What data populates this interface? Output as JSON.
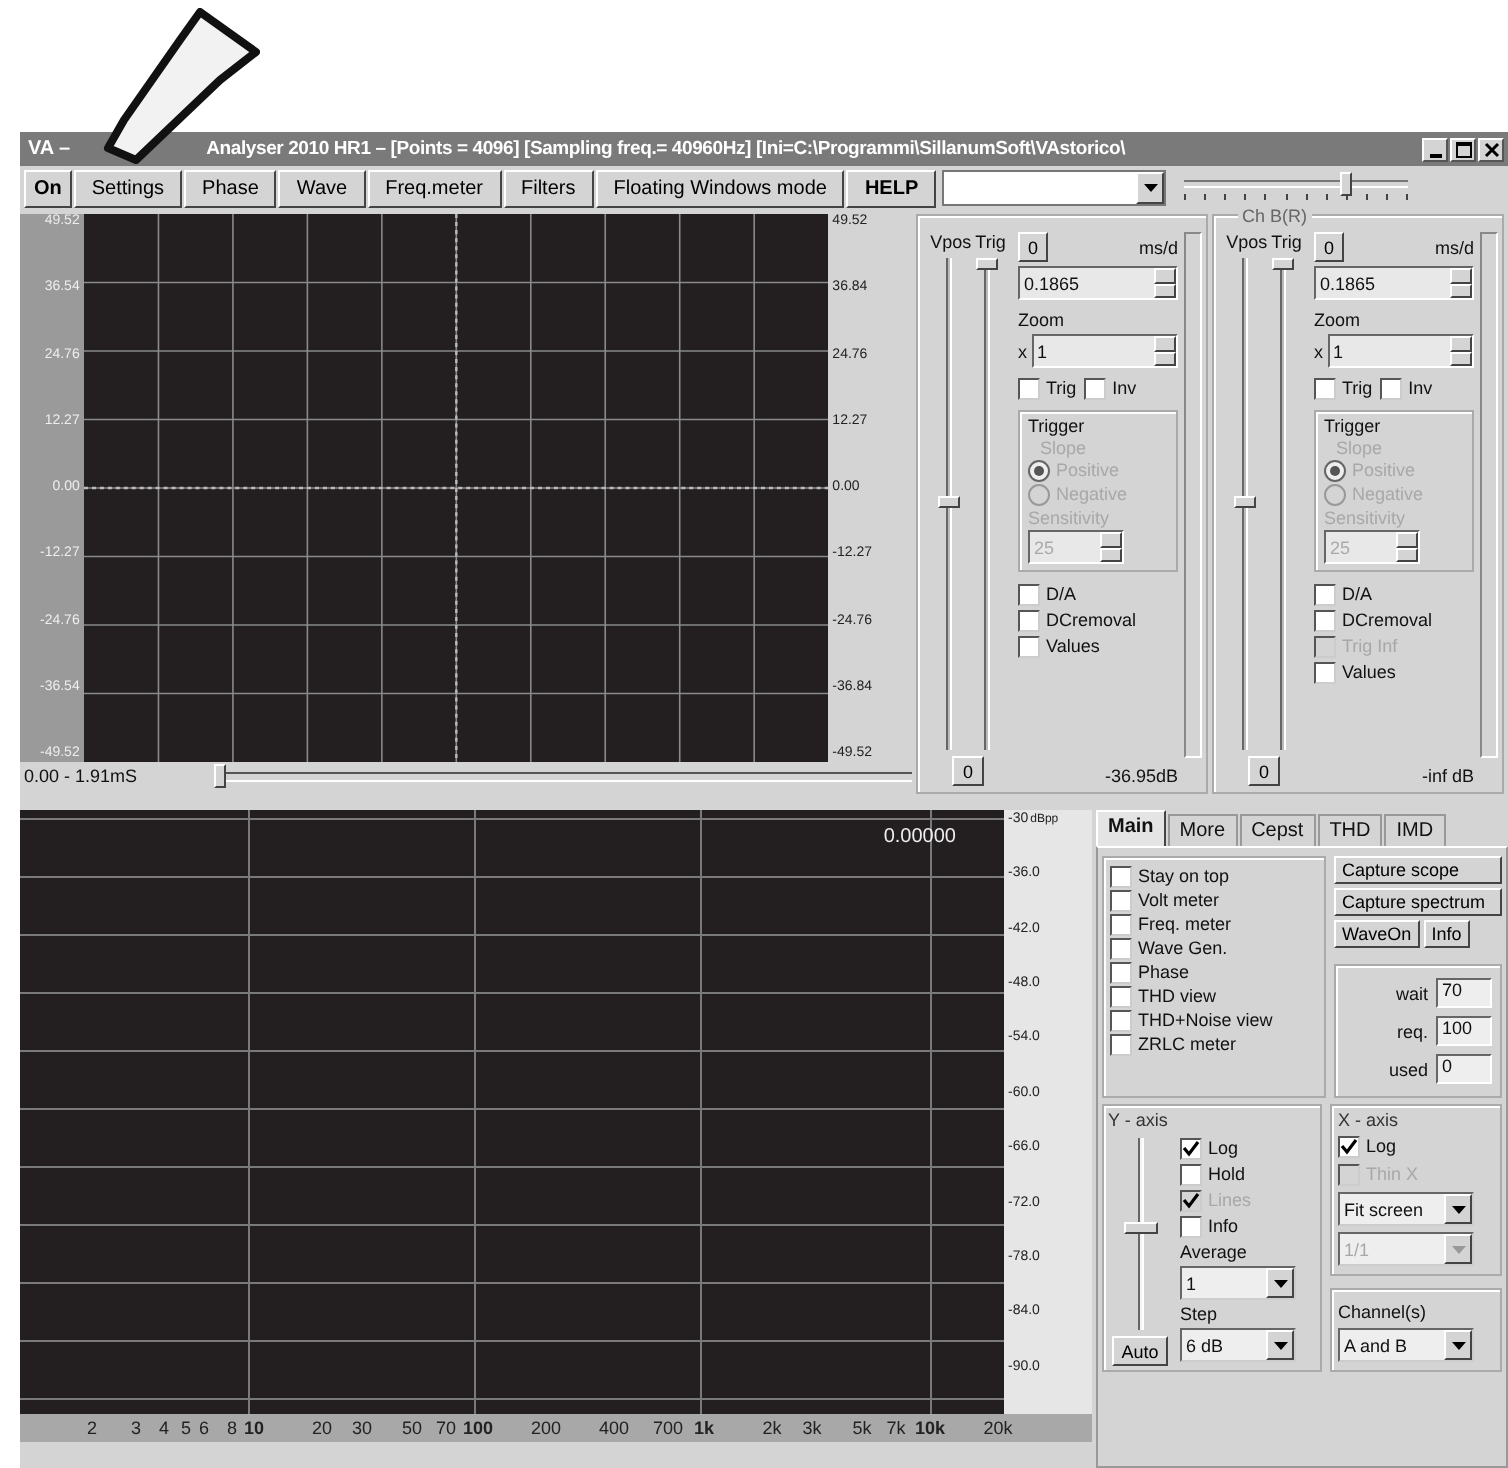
{
  "title_bar": {
    "app": "VA –",
    "title": "Analyser 2010 HR1 – [Points = 4096] [Sampling freq.= 40960Hz] [Ini=C:\\Programmi\\SillanumSoft\\VAstorico\\"
  },
  "toolbar": {
    "buttons": [
      {
        "label": "On",
        "bold": true
      },
      {
        "label": "Settings",
        "bold": false
      },
      {
        "label": "Phase",
        "bold": false
      },
      {
        "label": "Wave",
        "bold": false
      },
      {
        "label": "Freq.meter",
        "bold": false
      },
      {
        "label": "Filters",
        "bold": false
      },
      {
        "label": "Floating Windows mode",
        "bold": false
      },
      {
        "label": "HELP",
        "bold": true
      }
    ],
    "slider": {
      "level": 0.72
    }
  },
  "scope": {
    "left_axis": [
      "49.52",
      "36.54",
      "24.76",
      "12.27",
      "0.00",
      "-12.27",
      "-24.76",
      "-36.54",
      "-49.52"
    ],
    "right_axis": [
      "49.52",
      "36.84",
      "24.76",
      "12.27",
      "0.00",
      "-12.27",
      "-24.76",
      "-36.84",
      "-49.52"
    ],
    "time_range": "0.00 - 1.91mS",
    "position": {
      "level": 0
    }
  },
  "channels": [
    {
      "vpos_label": "Vpos",
      "trig_label": "Trig",
      "vpos": {
        "level": 0.5
      },
      "trig": {
        "level": 1
      },
      "top_button": "0",
      "ms_label": "ms/d",
      "ms_value": "0.1865",
      "zoom_label": "Zoom",
      "zoom_prefix": "x",
      "zoom_value": "1",
      "checks": [
        {
          "label": "Trig",
          "checked": false
        },
        {
          "label": "Inv",
          "checked": false
        }
      ],
      "trigger": {
        "title": "Trigger",
        "slope": "Slope",
        "options": [
          {
            "label": "Positive",
            "selected": true
          },
          {
            "label": "Negative",
            "selected": false
          }
        ],
        "sensitivity_label": "Sensitivity",
        "sensitivity_value": "25"
      },
      "options": [
        {
          "label": "D/A",
          "checked": false,
          "disabled": false
        },
        {
          "label": "DCremoval",
          "checked": false,
          "disabled": false
        },
        {
          "label": "Values",
          "checked": false,
          "disabled": false
        }
      ],
      "bottom_button": "0",
      "meter": {
        "level": 0
      },
      "reading": "-36.95dB"
    },
    {
      "title": "Ch B(R)",
      "vpos_label": "Vpos",
      "trig_label": "Trig",
      "vpos": {
        "level": 0.5
      },
      "trig": {
        "level": 1
      },
      "top_button": "0",
      "ms_label": "ms/d",
      "ms_value": "0.1865",
      "zoom_label": "Zoom",
      "zoom_prefix": "x",
      "zoom_value": "1",
      "checks": [
        {
          "label": "Trig",
          "checked": false
        },
        {
          "label": "Inv",
          "checked": false
        }
      ],
      "trigger": {
        "title": "Trigger",
        "slope": "Slope",
        "options": [
          {
            "label": "Positive",
            "selected": true
          },
          {
            "label": "Negative",
            "selected": false
          }
        ],
        "sensitivity_label": "Sensitivity",
        "sensitivity_value": "25"
      },
      "options": [
        {
          "label": "D/A",
          "checked": false,
          "disabled": false
        },
        {
          "label": "DCremoval",
          "checked": false,
          "disabled": false
        },
        {
          "label": "Trig Inf",
          "checked": false,
          "disabled": true
        },
        {
          "label": "Values",
          "checked": false,
          "disabled": false
        }
      ],
      "bottom_button": "0",
      "meter": {
        "level": 0
      },
      "reading": "-inf dB"
    }
  ],
  "spectrum": {
    "readout": "0.00000",
    "unit": "dBpp",
    "y_axis": [
      "-30",
      "-36.0",
      "-42.0",
      "-48.0",
      "-54.0",
      "-60.0",
      "-66.0",
      "-72.0",
      "-78.0",
      "-84.0",
      "-90.0"
    ],
    "x_axis": [
      {
        "label": "2",
        "bold": false
      },
      {
        "label": "3",
        "bold": false
      },
      {
        "label": "4",
        "bold": false
      },
      {
        "label": "5",
        "bold": false
      },
      {
        "label": "6",
        "bold": false
      },
      {
        "label": "8",
        "bold": false
      },
      {
        "label": "10",
        "bold": true
      },
      {
        "label": "20",
        "bold": false
      },
      {
        "label": "30",
        "bold": false
      },
      {
        "label": "50",
        "bold": false
      },
      {
        "label": "70",
        "bold": false
      },
      {
        "label": "100",
        "bold": true
      },
      {
        "label": "200",
        "bold": false
      },
      {
        "label": "400",
        "bold": false
      },
      {
        "label": "700",
        "bold": false
      },
      {
        "label": "1k",
        "bold": true
      },
      {
        "label": "2k",
        "bold": false
      },
      {
        "label": "3k",
        "bold": false
      },
      {
        "label": "5k",
        "bold": false
      },
      {
        "label": "7k",
        "bold": false
      },
      {
        "label": "10k",
        "bold": true
      },
      {
        "label": "20k",
        "bold": false
      }
    ]
  },
  "control_panel": {
    "tabs": [
      {
        "label": "Main",
        "selected": true
      },
      {
        "label": "More",
        "selected": false
      },
      {
        "label": "Cepst",
        "selected": false
      },
      {
        "label": "THD",
        "selected": false
      },
      {
        "label": "IMD",
        "selected": false
      }
    ],
    "view_options": [
      {
        "label": "Stay on top",
        "checked": false
      },
      {
        "label": "Volt meter",
        "checked": false
      },
      {
        "label": "Freq. meter",
        "checked": false
      },
      {
        "label": "Wave Gen.",
        "checked": false
      },
      {
        "label": "Phase",
        "checked": false
      },
      {
        "label": "THD view",
        "checked": false
      },
      {
        "label": "THD+Noise view",
        "checked": false
      },
      {
        "label": "ZRLC meter",
        "checked": false
      }
    ],
    "capture_buttons": [
      "Capture scope",
      "Capture spectrum"
    ],
    "small_buttons": [
      "WaveOn",
      "Info"
    ],
    "buffers": [
      {
        "label": "wait",
        "value": "70"
      },
      {
        "label": "req.",
        "value": "100"
      },
      {
        "label": "used",
        "value": "0"
      }
    ],
    "y_axis": {
      "title": "Y - axis",
      "slider": {
        "level": 0.55
      },
      "options": [
        {
          "label": "Log",
          "checked": true,
          "disabled": false
        },
        {
          "label": "Hold",
          "checked": false,
          "disabled": false
        },
        {
          "label": "Lines",
          "checked": true,
          "disabled": true
        },
        {
          "label": "Info",
          "checked": false,
          "disabled": false
        }
      ],
      "average_label": "Average",
      "average_value": "1",
      "step_label": "Step",
      "step_value": "6 dB",
      "auto_button": "Auto"
    },
    "x_axis": {
      "title": "X - axis",
      "options": [
        {
          "label": "Log",
          "checked": true,
          "disabled": false
        },
        {
          "label": "Thin X",
          "checked": false,
          "disabled": true
        }
      ],
      "scale": {
        "value": "Fit screen",
        "disabled": false
      },
      "zoom": {
        "value": "1/1",
        "disabled": true
      }
    },
    "channels_label": "Channel(s)",
    "channels_value": "A and B"
  }
}
